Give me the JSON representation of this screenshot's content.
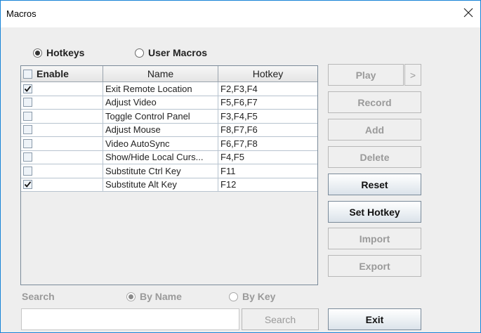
{
  "window": {
    "title": "Macros"
  },
  "mode": {
    "hotkeys_label": "Hotkeys",
    "user_macros_label": "User Macros",
    "selected": "Hotkeys"
  },
  "table": {
    "headers": {
      "enable": "Enable",
      "name": "Name",
      "hotkey": "Hotkey"
    },
    "rows": [
      {
        "enabled": true,
        "name": "Exit Remote Location",
        "hotkey": "F2,F3,F4"
      },
      {
        "enabled": false,
        "name": "Adjust Video",
        "hotkey": "F5,F6,F7"
      },
      {
        "enabled": false,
        "name": "Toggle Control Panel",
        "hotkey": "F3,F4,F5"
      },
      {
        "enabled": false,
        "name": "Adjust Mouse",
        "hotkey": "F8,F7,F6"
      },
      {
        "enabled": false,
        "name": "Video AutoSync",
        "hotkey": "F6,F7,F8"
      },
      {
        "enabled": false,
        "name": "Show/Hide Local Curs...",
        "hotkey": "F4,F5"
      },
      {
        "enabled": false,
        "name": "Substitute Ctrl Key",
        "hotkey": "F11"
      },
      {
        "enabled": true,
        "name": "Substitute Alt Key",
        "hotkey": "F12"
      }
    ]
  },
  "buttons": {
    "play": "Play",
    "play_more": ">",
    "record": "Record",
    "add": "Add",
    "delete": "Delete",
    "reset": "Reset",
    "set_hotkey": "Set Hotkey",
    "import": "Import",
    "export": "Export",
    "exit": "Exit"
  },
  "search": {
    "label": "Search",
    "by_name_label": "By Name",
    "by_key_label": "By Key",
    "selected": "By Name",
    "input_value": "",
    "button_label": "Search"
  }
}
